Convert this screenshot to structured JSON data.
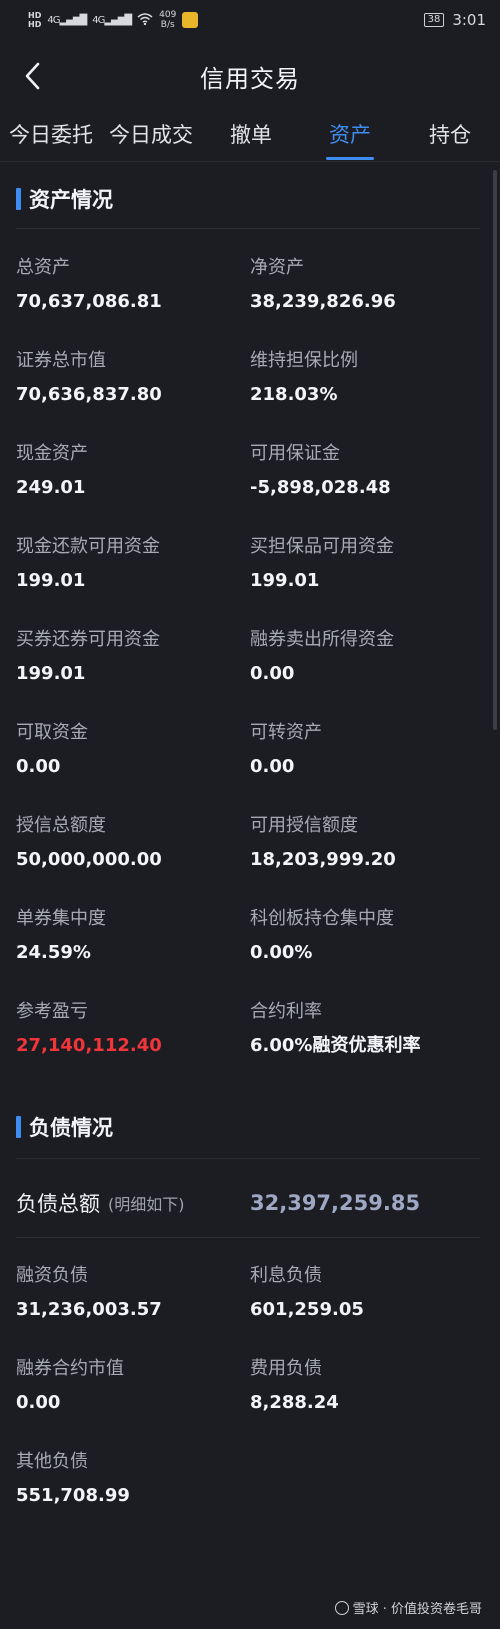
{
  "status_bar": {
    "hd1": "HD",
    "hd2": "HD",
    "net1": "4G",
    "net2": "4G",
    "speed_value": "409",
    "speed_unit": "B/s",
    "battery": "38",
    "time": "3:01"
  },
  "nav": {
    "title": "信用交易"
  },
  "tabs": [
    "今日委托",
    "今日成交",
    "撤单",
    "资产",
    "持仓"
  ],
  "active_tab": 3,
  "asset_section": {
    "title": "资产情况",
    "items": [
      {
        "label": "总资产",
        "value": "70,637,086.81"
      },
      {
        "label": "净资产",
        "value": "38,239,826.96"
      },
      {
        "label": "证券总市值",
        "value": "70,636,837.80"
      },
      {
        "label": "维持担保比例",
        "value": "218.03%"
      },
      {
        "label": "现金资产",
        "value": "249.01"
      },
      {
        "label": "可用保证金",
        "value": "-5,898,028.48"
      },
      {
        "label": "现金还款可用资金",
        "value": "199.01"
      },
      {
        "label": "买担保品可用资金",
        "value": "199.01"
      },
      {
        "label": "买券还券可用资金",
        "value": "199.01"
      },
      {
        "label": "融券卖出所得资金",
        "value": "0.00"
      },
      {
        "label": "可取资金",
        "value": "0.00"
      },
      {
        "label": "可转资产",
        "value": "0.00"
      },
      {
        "label": "授信总额度",
        "value": "50,000,000.00"
      },
      {
        "label": "可用授信额度",
        "value": "18,203,999.20"
      },
      {
        "label": "单券集中度",
        "value": "24.59%"
      },
      {
        "label": "科创板持仓集中度",
        "value": "0.00%"
      },
      {
        "label": "参考盈亏",
        "value": "27,140,112.40"
      },
      {
        "label": "合约利率",
        "value": "6.00%融资优惠利率"
      }
    ],
    "pnl_color": "#f2343b"
  },
  "liability_section": {
    "title": "负债情况",
    "total_label": "负债总额",
    "total_note": "(明细如下)",
    "total_value": "32,397,259.85",
    "items": [
      {
        "label": "融资负债",
        "value": "31,236,003.57"
      },
      {
        "label": "利息负债",
        "value": "601,259.05"
      },
      {
        "label": "融券合约市值",
        "value": "0.00"
      },
      {
        "label": "费用负债",
        "value": "8,288.24"
      },
      {
        "label": "其他负债",
        "value": "551,708.99"
      }
    ]
  },
  "watermark": {
    "text": "雪球 · 价值投资卷毛哥"
  },
  "accent_color": "#3d8df2"
}
